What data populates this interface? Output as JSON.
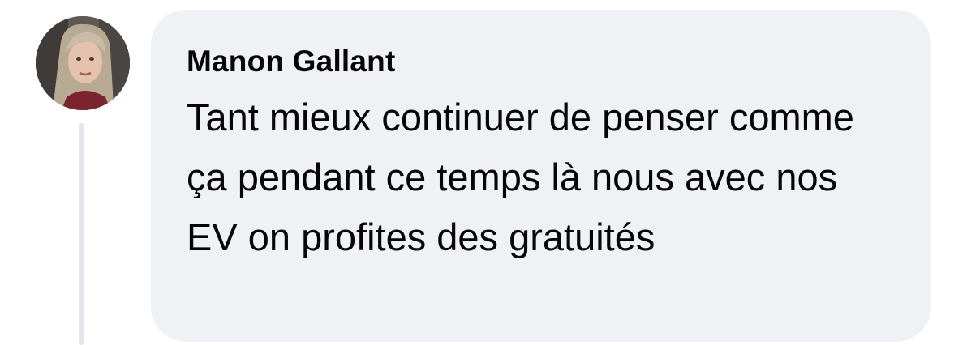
{
  "comment": {
    "author": "Manon Gallant",
    "text": "Tant mieux continuer de penser comme ça pendant ce temps là nous avec nos EV on profites des gratuités",
    "avatar_icon": "profile-photo"
  },
  "colors": {
    "bubble_background": "#f0f1f5",
    "text": "#050505",
    "thread_line": "#e4e6eb"
  }
}
